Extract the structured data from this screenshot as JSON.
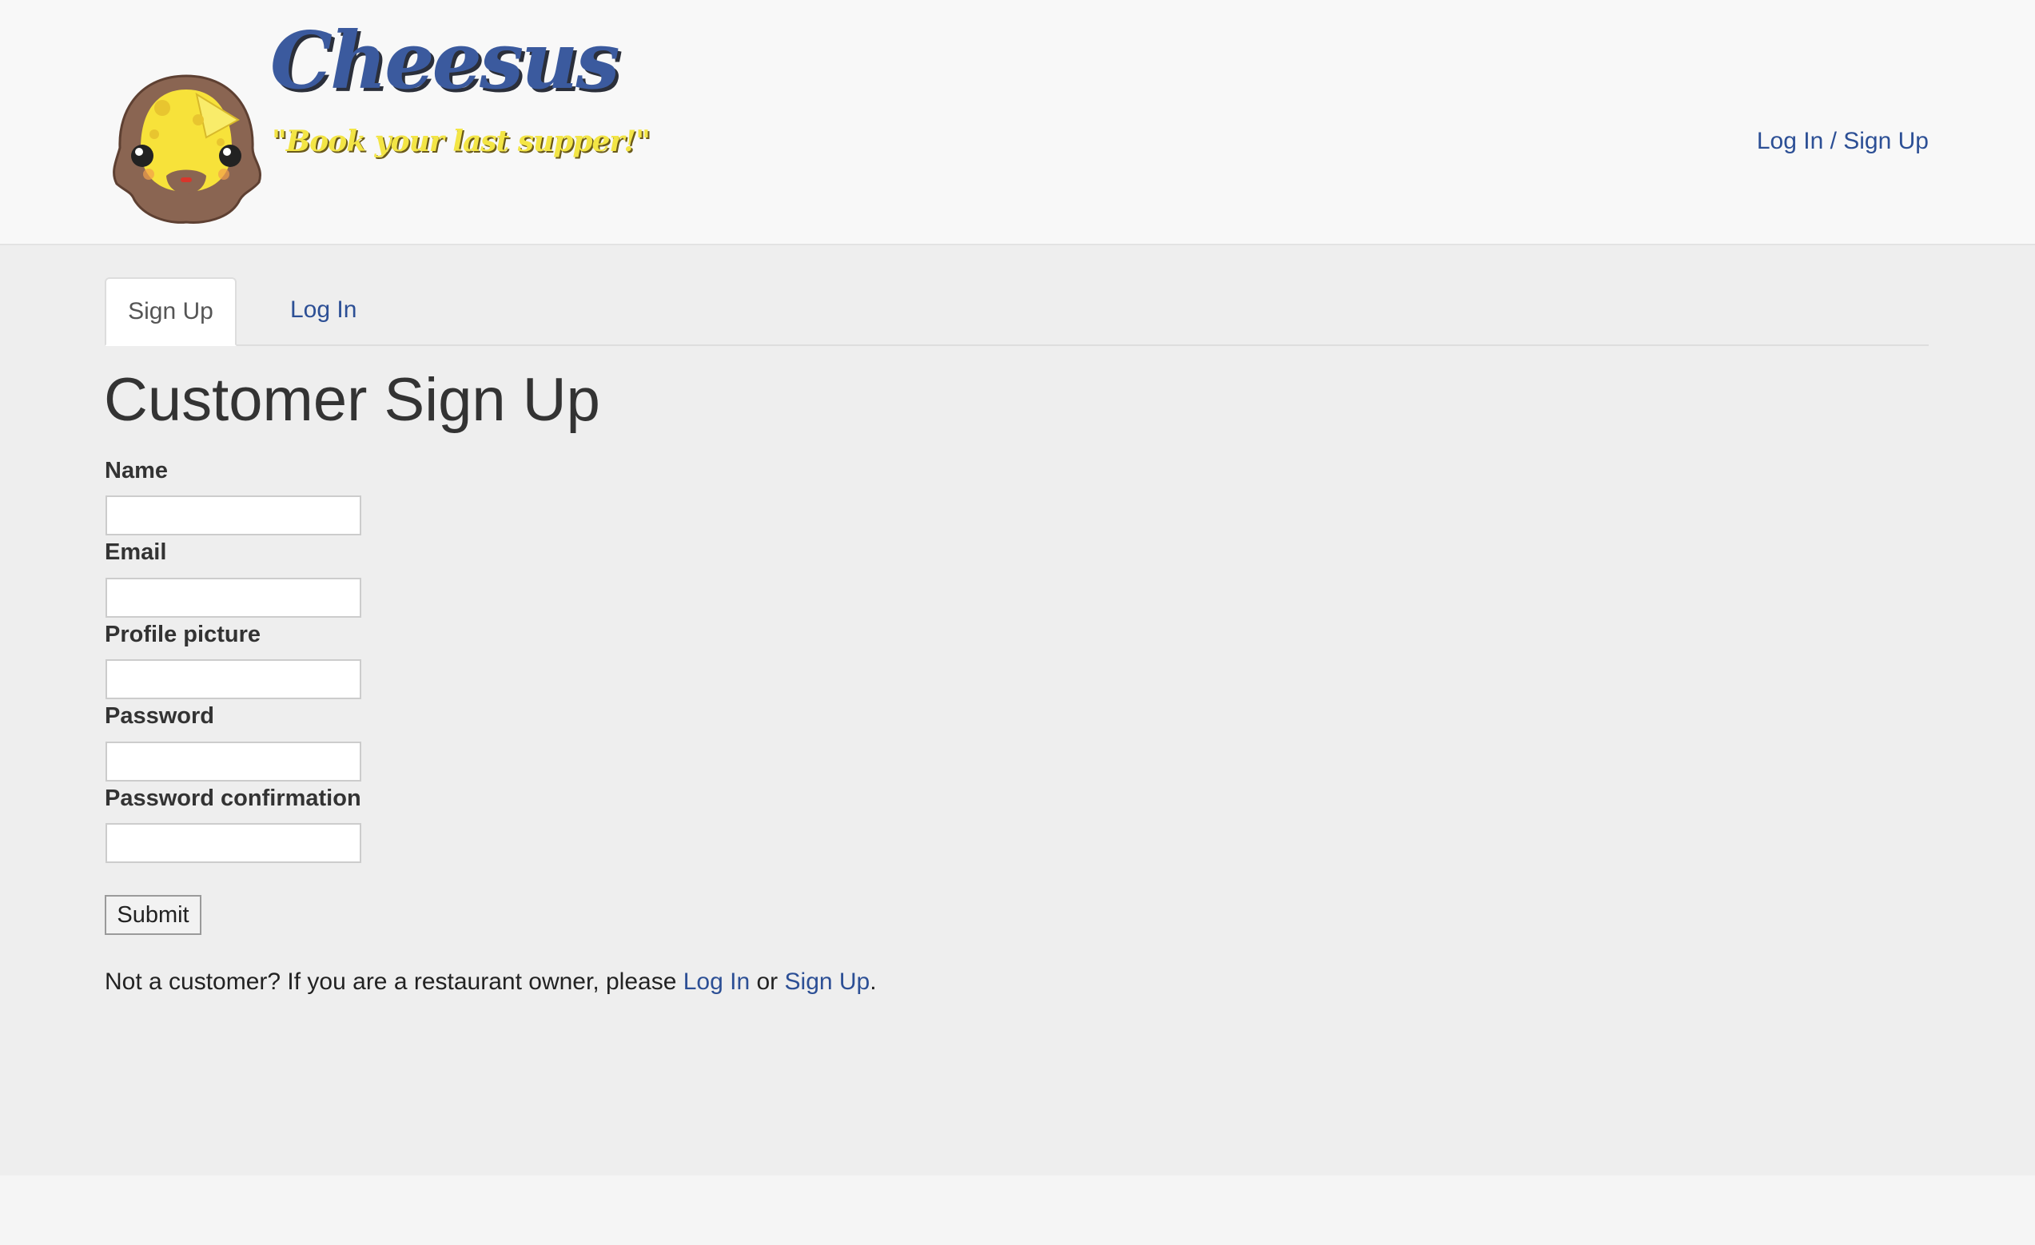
{
  "header": {
    "brand_name": "Cheesus",
    "tagline": "\"Book your last supper!\"",
    "auth_link": "Log In / Sign Up"
  },
  "tabs": [
    {
      "label": "Sign Up",
      "active": true
    },
    {
      "label": "Log In",
      "active": false
    }
  ],
  "form": {
    "title": "Customer Sign Up",
    "fields": [
      {
        "label": "Name",
        "value": ""
      },
      {
        "label": "Email",
        "value": ""
      },
      {
        "label": "Profile picture",
        "value": ""
      },
      {
        "label": "Password",
        "value": ""
      },
      {
        "label": "Password confirmation",
        "value": ""
      }
    ],
    "submit_label": "Submit"
  },
  "note": {
    "prefix": "Not a customer? If you are a restaurant owner, please ",
    "login_link": "Log In",
    "middle": " or ",
    "signup_link": "Sign Up",
    "suffix": "."
  },
  "colors": {
    "link": "#2c4f95",
    "brand": "#3b5a9e",
    "tagline": "#f3e545"
  },
  "icons": {
    "logo": "cheese-jesus-face-icon"
  }
}
